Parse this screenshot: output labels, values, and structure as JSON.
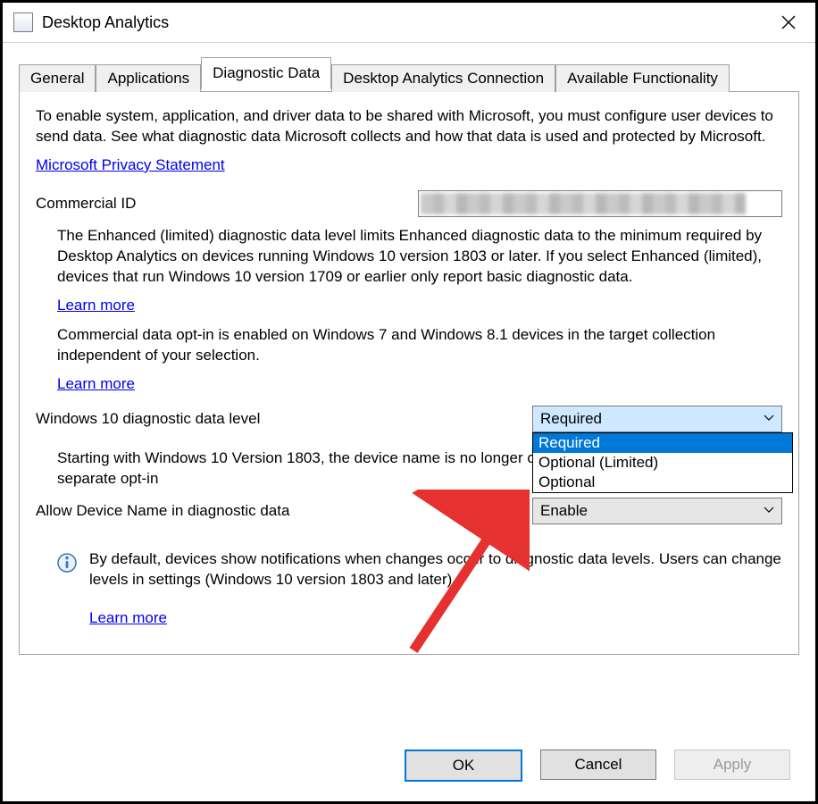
{
  "window": {
    "title": "Desktop Analytics"
  },
  "tabs": {
    "general": "General",
    "applications": "Applications",
    "diagnostic": "Diagnostic Data",
    "connection": "Desktop Analytics Connection",
    "functionality": "Available Functionality"
  },
  "intro": "To enable system, application, and driver data to be shared with Microsoft, you must configure user devices to send data. See what diagnostic data Microsoft collects and how that data is used and protected by Microsoft.",
  "privacy_link": "Microsoft Privacy Statement",
  "commercial_id": {
    "label": "Commercial ID"
  },
  "enhanced_text": "The Enhanced (limited) diagnostic data level limits Enhanced diagnostic data to the minimum required by Desktop Analytics on devices running Windows 10 version 1803 or later. If you select Enhanced (limited), devices that run Windows 10 version 1709 or earlier only report basic diagnostic data.",
  "learn_more": "Learn more",
  "optin_text": "Commercial data opt-in is enabled on Windows 7 and Windows 8.1 devices in the target collection independent of your selection.",
  "level": {
    "label": "Windows 10 diagnostic data level",
    "selected": "Required",
    "options": [
      "Required",
      "Optional (Limited)",
      "Optional"
    ]
  },
  "device_name_note": "Starting with Windows 10 Version 1803, the device name is no longer collected by default and requires a separate opt-in",
  "allow_device": {
    "label": "Allow Device Name in diagnostic data",
    "selected": "Enable"
  },
  "notice": "By default, devices show notifications when changes occur to diagnostic data levels. Users can change levels in settings (Windows 10 version 1803 and later).",
  "buttons": {
    "ok": "OK",
    "cancel": "Cancel",
    "apply": "Apply"
  }
}
